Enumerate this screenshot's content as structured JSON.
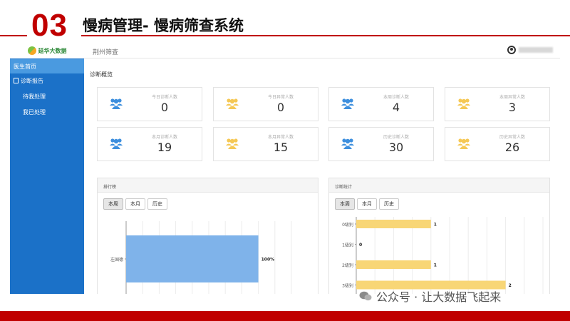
{
  "slide": {
    "number": "03",
    "title": "慢病管理- 慢病筛查系统",
    "watermark": "公众号 · 让大数据飞起来"
  },
  "colors": {
    "accent_red": "#c00000",
    "sidebar_blue": "#1b71c8",
    "icon_blue": "#3d8fde",
    "icon_yellow": "#f5c855",
    "bar_blue": "#7fb3ea",
    "bar_yellow": "#f8d676"
  },
  "app": {
    "logo_text": "延华大数据",
    "header_city": "荆州筛查",
    "sidebar": {
      "items": [
        {
          "label": "医生首页",
          "icon": "",
          "active": true
        },
        {
          "label": "诊断报告",
          "icon": "report-icon",
          "active": false
        },
        {
          "label": "待我处理",
          "icon": "",
          "active": false
        },
        {
          "label": "我已处理",
          "icon": "",
          "active": false
        }
      ]
    },
    "overview": {
      "title": "诊断概览",
      "cards": [
        {
          "label": "今日诊断人数",
          "value": "0",
          "icon": "users-icon",
          "color": "blue"
        },
        {
          "label": "今日异常人数",
          "value": "0",
          "icon": "users-icon",
          "color": "yellow"
        },
        {
          "label": "本周诊断人数",
          "value": "4",
          "icon": "users-icon",
          "color": "blue"
        },
        {
          "label": "本周异常人数",
          "value": "3",
          "icon": "users-icon",
          "color": "yellow"
        },
        {
          "label": "本月诊断人数",
          "value": "19",
          "icon": "users-icon",
          "color": "blue"
        },
        {
          "label": "本月异常人数",
          "value": "15",
          "icon": "users-icon",
          "color": "yellow"
        },
        {
          "label": "历史诊断人数",
          "value": "30",
          "icon": "users-icon",
          "color": "blue"
        },
        {
          "label": "历史异常人数",
          "value": "26",
          "icon": "users-icon",
          "color": "yellow"
        }
      ]
    },
    "panels": [
      {
        "title": "排行榜",
        "tabs": [
          {
            "label": "本周",
            "active": true
          },
          {
            "label": "本月",
            "active": false
          },
          {
            "label": "历史",
            "active": false
          }
        ]
      },
      {
        "title": "诊断统计",
        "tabs": [
          {
            "label": "本周",
            "active": true
          },
          {
            "label": "本月",
            "active": false
          },
          {
            "label": "历史",
            "active": false
          }
        ]
      }
    ]
  },
  "chart_data": [
    {
      "type": "bar",
      "orientation": "horizontal",
      "categories": [
        "左国德"
      ],
      "values": [
        100
      ],
      "value_labels": [
        "100%"
      ],
      "xlim": [
        0,
        125
      ]
    },
    {
      "type": "bar",
      "orientation": "horizontal",
      "categories": [
        "0级别",
        "1级别",
        "2级别",
        "3级别"
      ],
      "values": [
        1,
        0,
        1,
        2
      ],
      "value_labels": [
        "1",
        "0",
        "1",
        "2"
      ],
      "xlim": [
        0,
        2.5
      ]
    }
  ]
}
